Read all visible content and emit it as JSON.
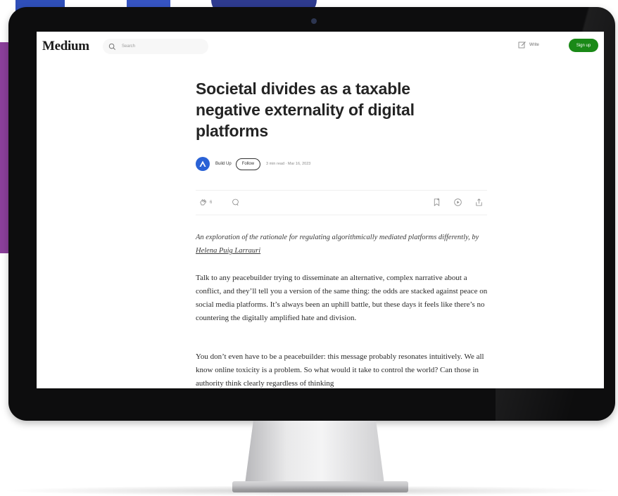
{
  "app": {
    "logo": "Medium"
  },
  "header": {
    "search_placeholder": "Search",
    "write_label": "Write",
    "signup_label": "Sign up"
  },
  "article": {
    "title": "Societal divides as a taxable negative externality of digital platforms",
    "author": "Build Up",
    "follow_label": "Follow",
    "meta": "3 min read · Mar 16, 2023",
    "clap_count": "6",
    "intro_text": "An exploration of the rationale for regulating algorithmically mediated platforms differently, by ",
    "intro_author": "Helena Puig Larrauri",
    "paragraphs": [
      "Talk to any peacebuilder trying to disseminate an alternative, complex narrative about a conflict, and they’ll tell you a version of the same thing: the odds are stacked against peace on social media platforms. It’s always been an uphill battle, but these days it feels like there’s no countering the digitally amplified hate and division.",
      "You don’t even have to be a peacebuilder: this message probably resonates intuitively. We all know online toxicity is a problem. So what would it take to control the world? Can those in authority think clearly regardless of thinking"
    ]
  },
  "icons": [
    "search-icon",
    "write-icon",
    "clap-icon",
    "comment-icon",
    "bookmark-icon",
    "listen-icon",
    "share-icon",
    "avatar-logo-icon"
  ],
  "colors": {
    "signup": "#1a8917",
    "avatar": "#2a62d6",
    "bezel": "#0d0d0e"
  }
}
